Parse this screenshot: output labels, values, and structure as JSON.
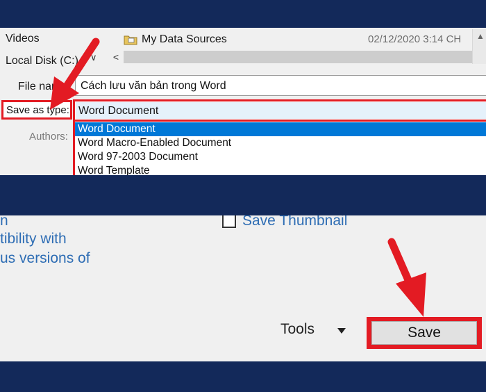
{
  "nav": {
    "videos": "Videos",
    "local_disk": "Local Disk (C:)",
    "data_sources": "My Data Sources",
    "date_modified": "02/12/2020 3:14 CH"
  },
  "form": {
    "filename_label": "File name:",
    "filename_value": "Cách lưu văn bản trong Word",
    "saveas_label": "Save as type:",
    "saveas_value": "Word Document",
    "authors_label": "Authors:"
  },
  "dropdown": {
    "options": [
      "Word Document",
      "Word Macro-Enabled Document",
      "Word 97-2003 Document",
      "Word Template"
    ],
    "selected_index": 0
  },
  "bottom": {
    "compat_lines": [
      "n",
      "tibility with",
      "us versions of"
    ],
    "thumbnail_label": "Save Thumbnail",
    "thumbnail_checked": false,
    "tools_label": "Tools",
    "save_label": "Save"
  },
  "colors": {
    "highlight_red": "#e31b23",
    "frame_navy": "#13295a",
    "selection_blue": "#0078d7",
    "link_blue": "#2e6db4"
  },
  "icons": {
    "folder": "folder-icon",
    "chevron": "chevron-down-icon",
    "scroll_left": "chevron-left-icon",
    "dropdown_caret": "caret-down-icon"
  }
}
